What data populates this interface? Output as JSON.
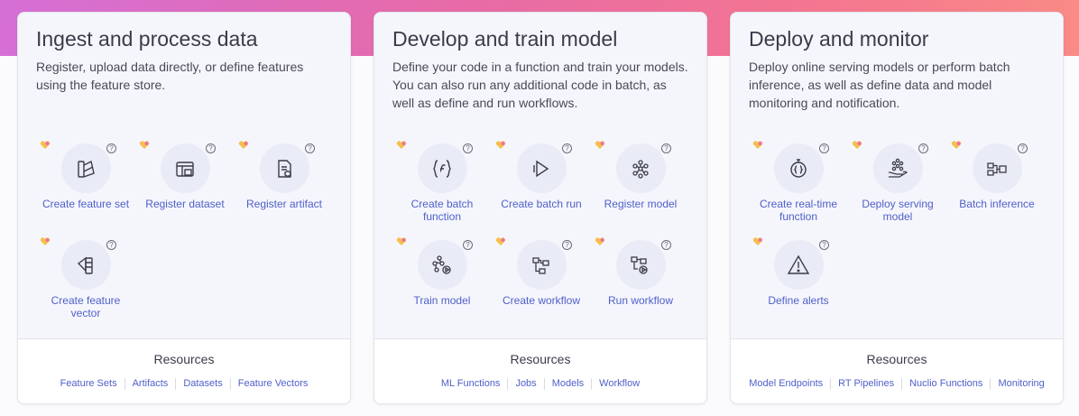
{
  "cards": [
    {
      "title": "Ingest and process data",
      "description": "Register, upload data directly, or define features using the feature store.",
      "actions": [
        {
          "label": "Create feature set",
          "icon": "feature-set-icon"
        },
        {
          "label": "Register dataset",
          "icon": "dataset-icon"
        },
        {
          "label": "Register artifact",
          "icon": "artifact-icon"
        },
        {
          "label": "Create feature vector",
          "icon": "feature-vector-icon"
        }
      ],
      "resources_title": "Resources",
      "resources": [
        "Feature Sets",
        "Artifacts",
        "Datasets",
        "Feature Vectors"
      ]
    },
    {
      "title": "Develop and train model",
      "description": "Define your code in a function and train your models. You can also run any additional code in batch, as well as define and run workflows.",
      "actions": [
        {
          "label": "Create batch function",
          "icon": "batch-function-icon"
        },
        {
          "label": "Create batch run",
          "icon": "play-icon"
        },
        {
          "label": "Register model",
          "icon": "model-icon"
        },
        {
          "label": "Train model",
          "icon": "train-model-icon"
        },
        {
          "label": "Create workflow",
          "icon": "workflow-icon"
        },
        {
          "label": "Run workflow",
          "icon": "run-workflow-icon"
        }
      ],
      "resources_title": "Resources",
      "resources": [
        "ML Functions",
        "Jobs",
        "Models",
        "Workflow"
      ]
    },
    {
      "title": "Deploy and monitor",
      "description": "Deploy online serving models or perform batch inference, as well as define data and model monitoring and notification.",
      "actions": [
        {
          "label": "Create real-time function",
          "icon": "realtime-function-icon"
        },
        {
          "label": "Deploy serving model",
          "icon": "serving-model-icon"
        },
        {
          "label": "Batch inference",
          "icon": "batch-inference-icon"
        },
        {
          "label": "Define alerts",
          "icon": "alert-icon"
        }
      ],
      "resources_title": "Resources",
      "resources": [
        "Model Endpoints",
        "RT Pipelines",
        "Nuclio Functions",
        "Monitoring"
      ]
    }
  ],
  "help_glyph": "?",
  "colors": {
    "link": "#4f5fc8",
    "title": "#3b3b4a",
    "card_bg": "#f5f6fc",
    "heart_pink": "#ee6fa6",
    "heart_yellow": "#f5c04a"
  }
}
